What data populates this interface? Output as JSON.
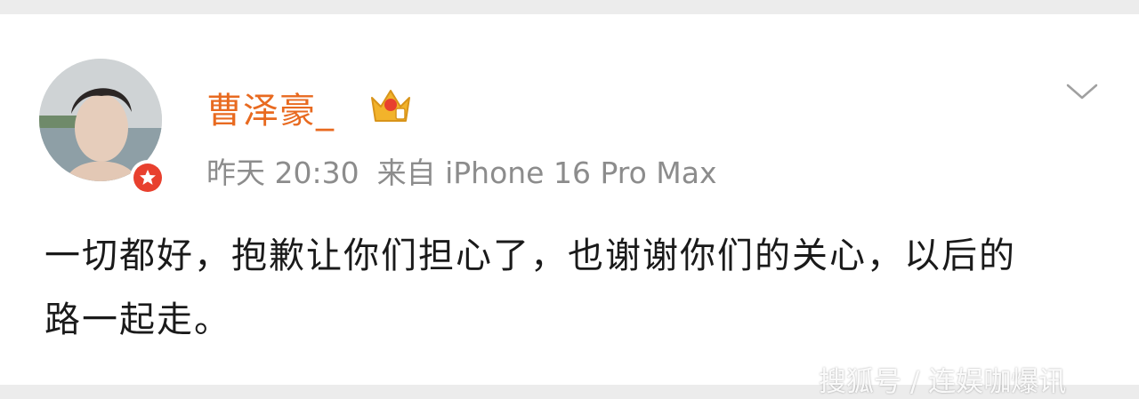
{
  "post": {
    "username": "曹泽豪_",
    "time": "昨天 20:30",
    "source": "来自 iPhone 16 Pro Max",
    "content": "一切都好，抱歉让你们担心了，也谢谢你们的关心，以后的路一起走。"
  },
  "icons": {
    "avatar": "avatar",
    "verified_badge": "verified-star-icon",
    "member_badge": "crown-icon",
    "menu": "chevron-down-icon"
  },
  "colors": {
    "username": "#e86a20",
    "meta_text": "#8c8c8c",
    "badge": "#e8402e",
    "crown": "#f2b32b"
  },
  "watermark": "搜狐号 / 连娱咖爆讯"
}
